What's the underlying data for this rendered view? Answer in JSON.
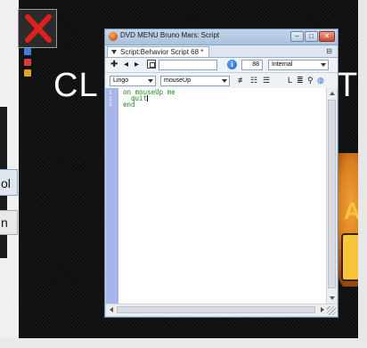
{
  "background": {
    "heading_left": "CL",
    "heading_right": "T",
    "logo_letter": "A",
    "left_box_a": "ol",
    "left_box_b": "n"
  },
  "window": {
    "title": "DVD MENU Bruno Mars: Script",
    "minimize_label": "–",
    "maximize_label": "□",
    "close_label": "✕"
  },
  "tab": {
    "label": "Script:Behavior Script 68 *"
  },
  "toolbar1": {
    "member_name": "",
    "zoom_value": "88",
    "scope_select": "Internal"
  },
  "toolbar2": {
    "language_select": "Lingo",
    "handler_select": "mouseUp"
  },
  "editor": {
    "line_numbers": [
      "1",
      "2",
      "3"
    ],
    "lines": [
      "on mouseUp me",
      "  quit",
      "end"
    ]
  },
  "colors": {
    "gutter": "#a7b5eb",
    "code": "#1d8a1d",
    "title_gradient_top": "#c3d5ea",
    "close_red": "#c94b2e",
    "stage_bg": "#0c0c0c"
  },
  "icons": [
    "close-x-icon",
    "app-icon",
    "dropdown-triangle-icon",
    "pin-icon",
    "forward-icon",
    "back-icon",
    "play-icon",
    "member-icon",
    "info-icon",
    "comment-icon",
    "uncomment-icon",
    "toggle-icon",
    "linkage-icon",
    "alphabetical-icon",
    "search-icon",
    "globe-icon"
  ]
}
